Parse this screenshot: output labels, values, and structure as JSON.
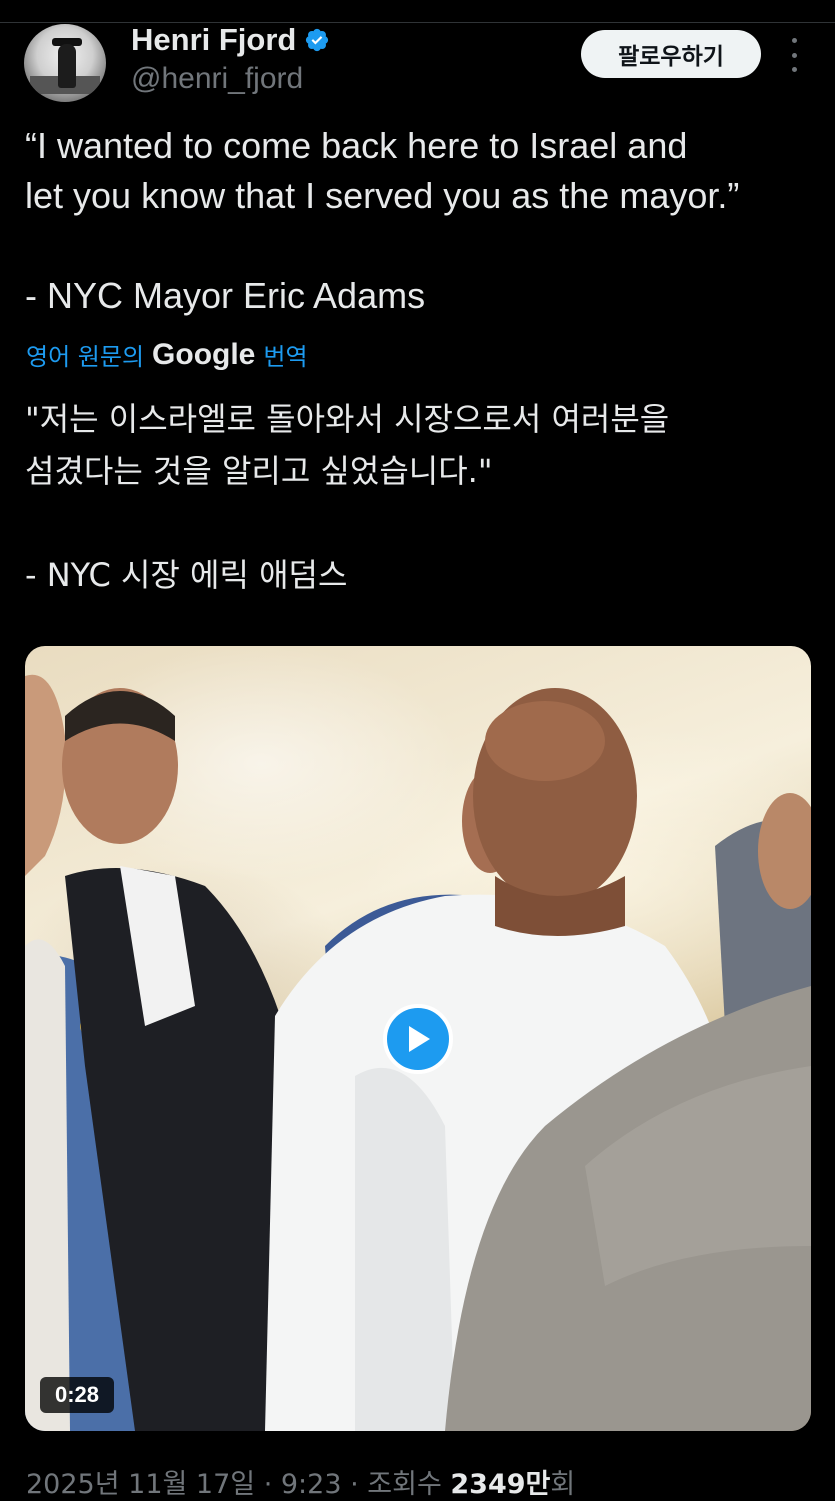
{
  "author": {
    "display_name": "Henri Fjord",
    "handle": "@henri_fjord",
    "verified": true
  },
  "actions": {
    "follow_label": "팔로우하기",
    "more_icon": "more-vertical-icon"
  },
  "tweet": {
    "lines": [
      "“I wanted to come back here to Israel and",
      "let you know that I served you as the mayor.”"
    ],
    "attribution": "- NYC Mayor Eric Adams"
  },
  "translation": {
    "prefix": "영어 원문의",
    "provider": "Google",
    "suffix": "번역",
    "lines": [
      "\"저는 이스라엘로 돌아와서 시장으로서 여러분을",
      "섬겼다는 것을 알리고 싶었습니다.\""
    ],
    "attribution": "- NYC 시장 에릭 애덤스"
  },
  "media": {
    "type": "video",
    "duration": "0:28",
    "play_icon": "play-icon"
  },
  "meta": {
    "date": "2025년 11월 17일",
    "separator": " · ",
    "time": "9:23",
    "views_label": "조회수",
    "views_count": "2349만",
    "views_suffix": "회"
  },
  "colors": {
    "background": "#000000",
    "text": "#e7e9ea",
    "secondary": "#71767b",
    "accent": "#1d9bf0"
  }
}
